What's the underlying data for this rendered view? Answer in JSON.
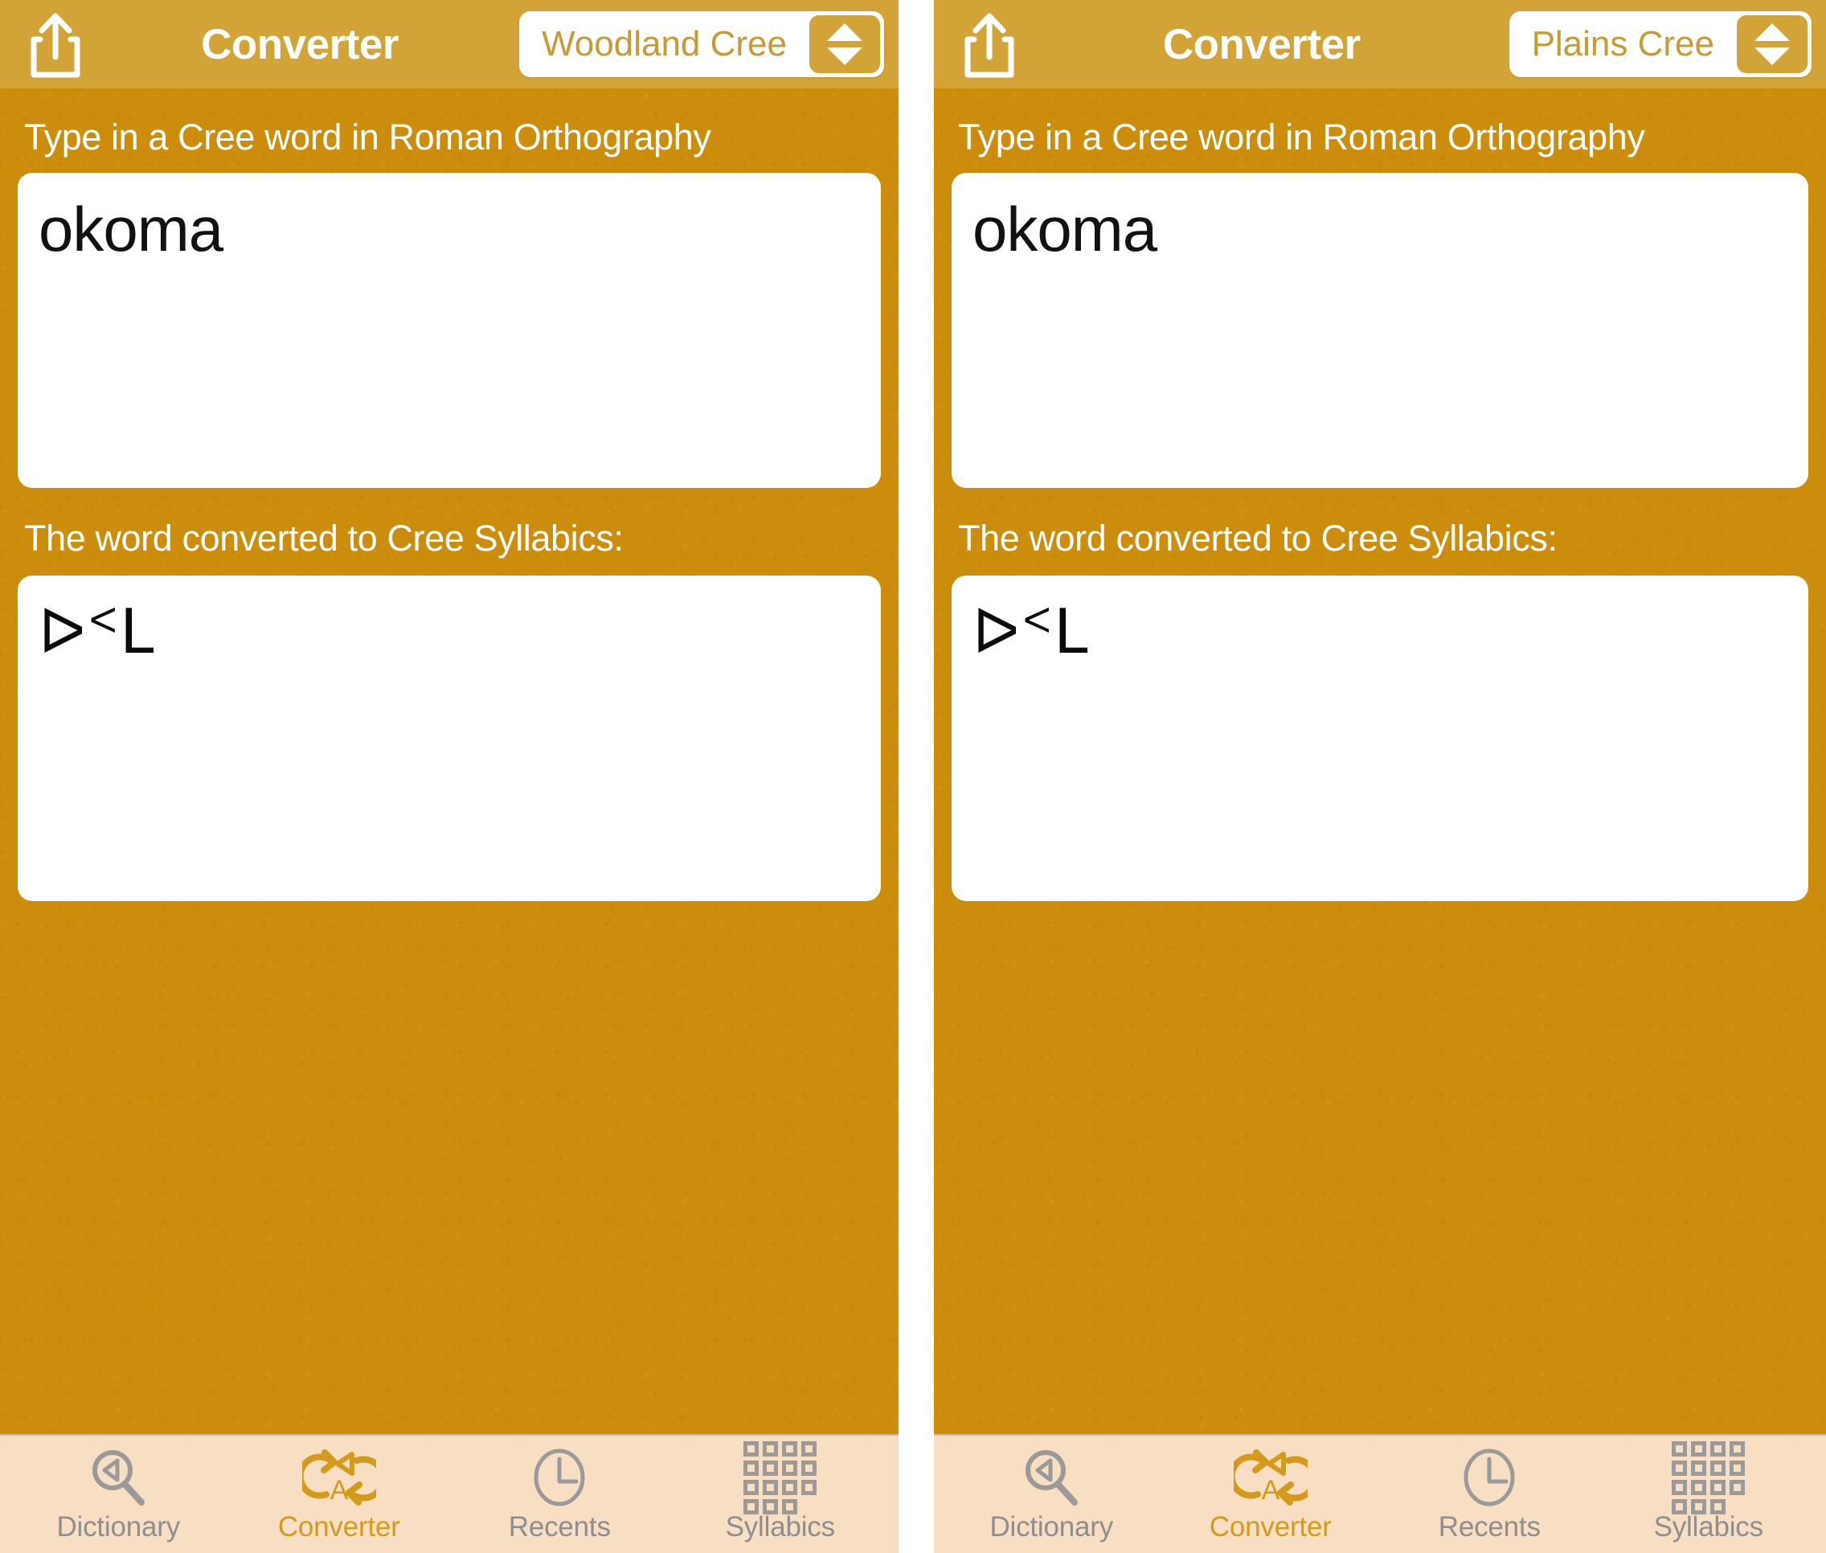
{
  "panels": [
    {
      "navbar": {
        "share_icon": "share-icon",
        "title": "Converter",
        "language_selected": "Woodland Cree",
        "stepper_up_icon": "triangle-up-icon",
        "stepper_down_icon": "triangle-down-icon"
      },
      "input": {
        "label": "Type in a Cree word in Roman Orthography",
        "value": "okoma"
      },
      "output": {
        "label": "The word converted to Cree Syllabics:",
        "value": "ᐅᑉᒪ"
      },
      "tabs": [
        {
          "label": "Dictionary",
          "icon": "magnifier-icon",
          "active": false
        },
        {
          "label": "Converter",
          "icon": "convert-arrows-icon",
          "active": true
        },
        {
          "label": "Recents",
          "icon": "clock-icon",
          "active": false
        },
        {
          "label": "Syllabics",
          "icon": "grid-icon",
          "active": false
        }
      ]
    },
    {
      "navbar": {
        "share_icon": "share-icon",
        "title": "Converter",
        "language_selected": "Plains Cree",
        "stepper_up_icon": "triangle-up-icon",
        "stepper_down_icon": "triangle-down-icon"
      },
      "input": {
        "label": "Type in a Cree word in Roman Orthography",
        "value": "okoma"
      },
      "output": {
        "label": "The word converted to Cree Syllabics:",
        "value": "ᐅᑉᒪ"
      },
      "tabs": [
        {
          "label": "Dictionary",
          "icon": "magnifier-icon",
          "active": false
        },
        {
          "label": "Converter",
          "icon": "convert-arrows-icon",
          "active": true
        },
        {
          "label": "Recents",
          "icon": "clock-icon",
          "active": false
        },
        {
          "label": "Syllabics",
          "icon": "grid-icon",
          "active": false
        }
      ]
    }
  ],
  "colors": {
    "navbar_background": "#d2a337",
    "body_background": "#cc8c0c",
    "tabbar_background": "#f8dfc3",
    "accent_gold": "#d49a1c",
    "inactive_gray": "#8e8e8e",
    "select_text": "#c79a33"
  }
}
